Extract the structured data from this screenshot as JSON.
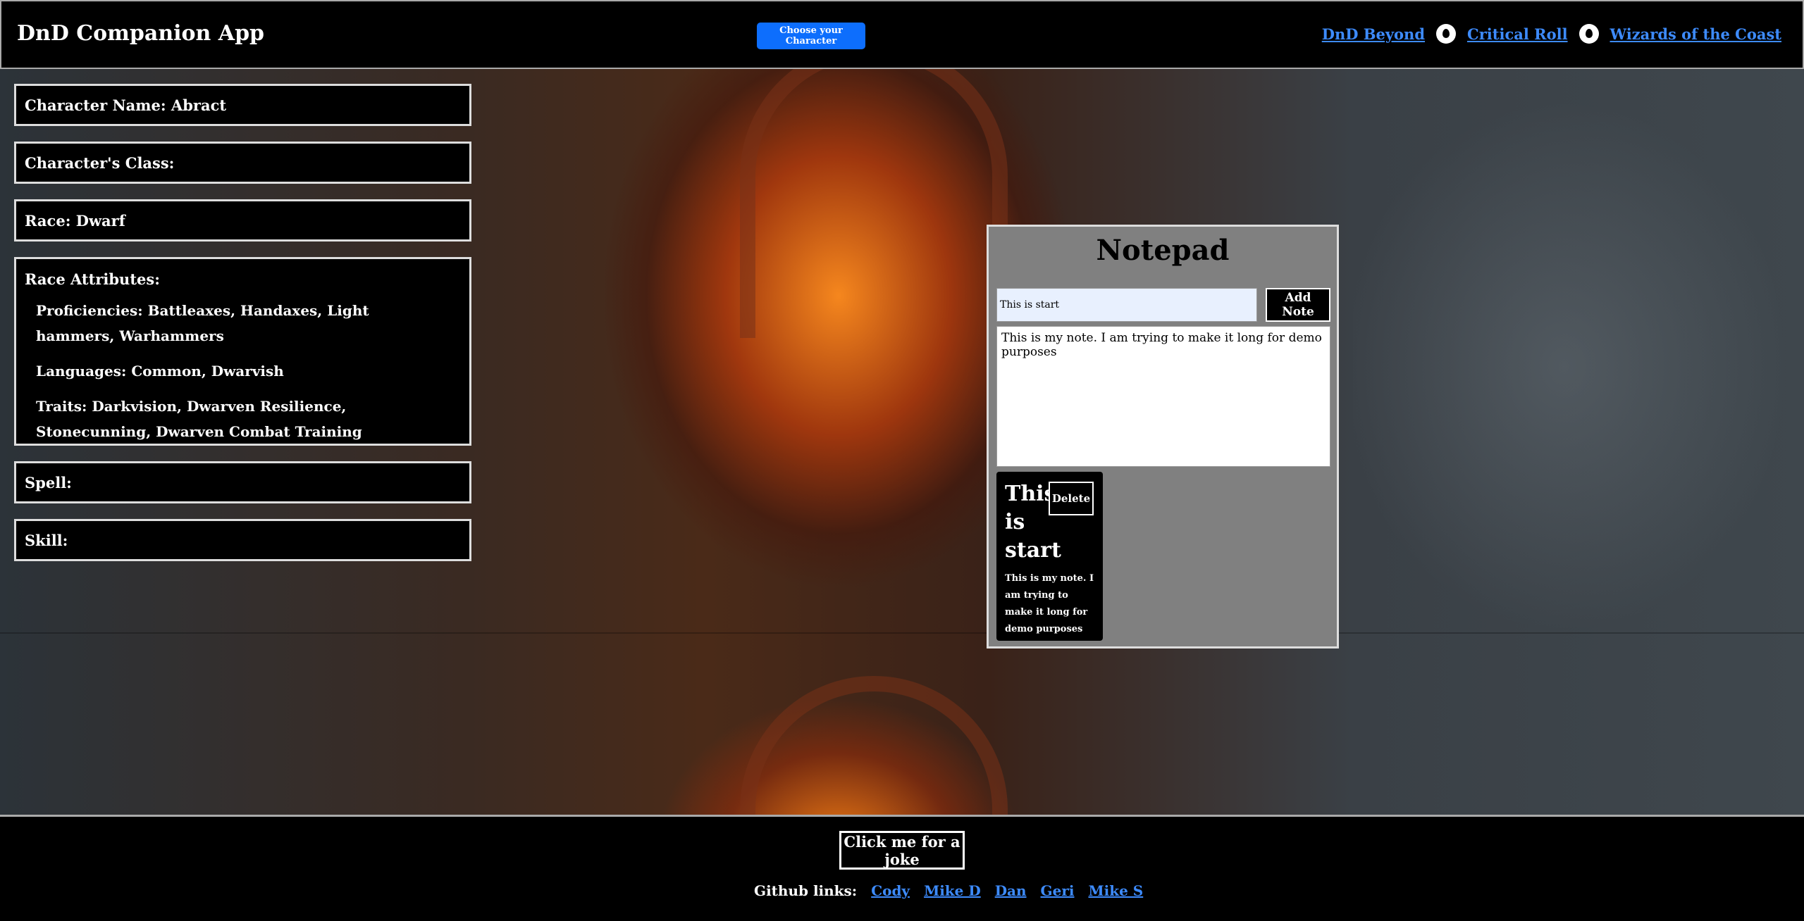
{
  "header": {
    "title": "DnD Companion App",
    "choose_button": "Choose your Character",
    "links": [
      {
        "label": "DnD Beyond",
        "icon": "flame-icon"
      },
      {
        "label": "Critical Roll",
        "icon": "flame-icon"
      },
      {
        "label": "Wizards of the Coast"
      }
    ]
  },
  "character": {
    "name": "Character Name: Abract",
    "class": "Character's Class:",
    "race": "Race: Dwarf",
    "attributes_title": "Race Attributes:",
    "proficiencies": "Proficiencies: Battleaxes, Handaxes, Light hammers, Warhammers",
    "languages": "Languages: Common, Dwarvish",
    "traits": "Traits: Darkvision, Dwarven Resilience, Stonecunning, Dwarven Combat Training",
    "spell": "Spell:",
    "skill": "Skill:"
  },
  "notepad": {
    "title": "Notepad",
    "title_input_value": "This is start",
    "add_button": "Add Note",
    "text_value": "This is my note. I am trying to make it long for demo purposes",
    "notes": [
      {
        "title": "This is start",
        "body": "This is my note. I am trying to make it long for demo purposes",
        "delete_label": "Delete"
      }
    ]
  },
  "footer": {
    "joke_button": "Click me for a joke",
    "github_label": "Github links:",
    "github_links": [
      "Cody",
      "Mike D",
      "Dan",
      "Geri",
      "Mike S"
    ]
  },
  "colors": {
    "accent": "#0d6efd",
    "link": "#3d8bfd",
    "notepad_bg": "#808080"
  }
}
